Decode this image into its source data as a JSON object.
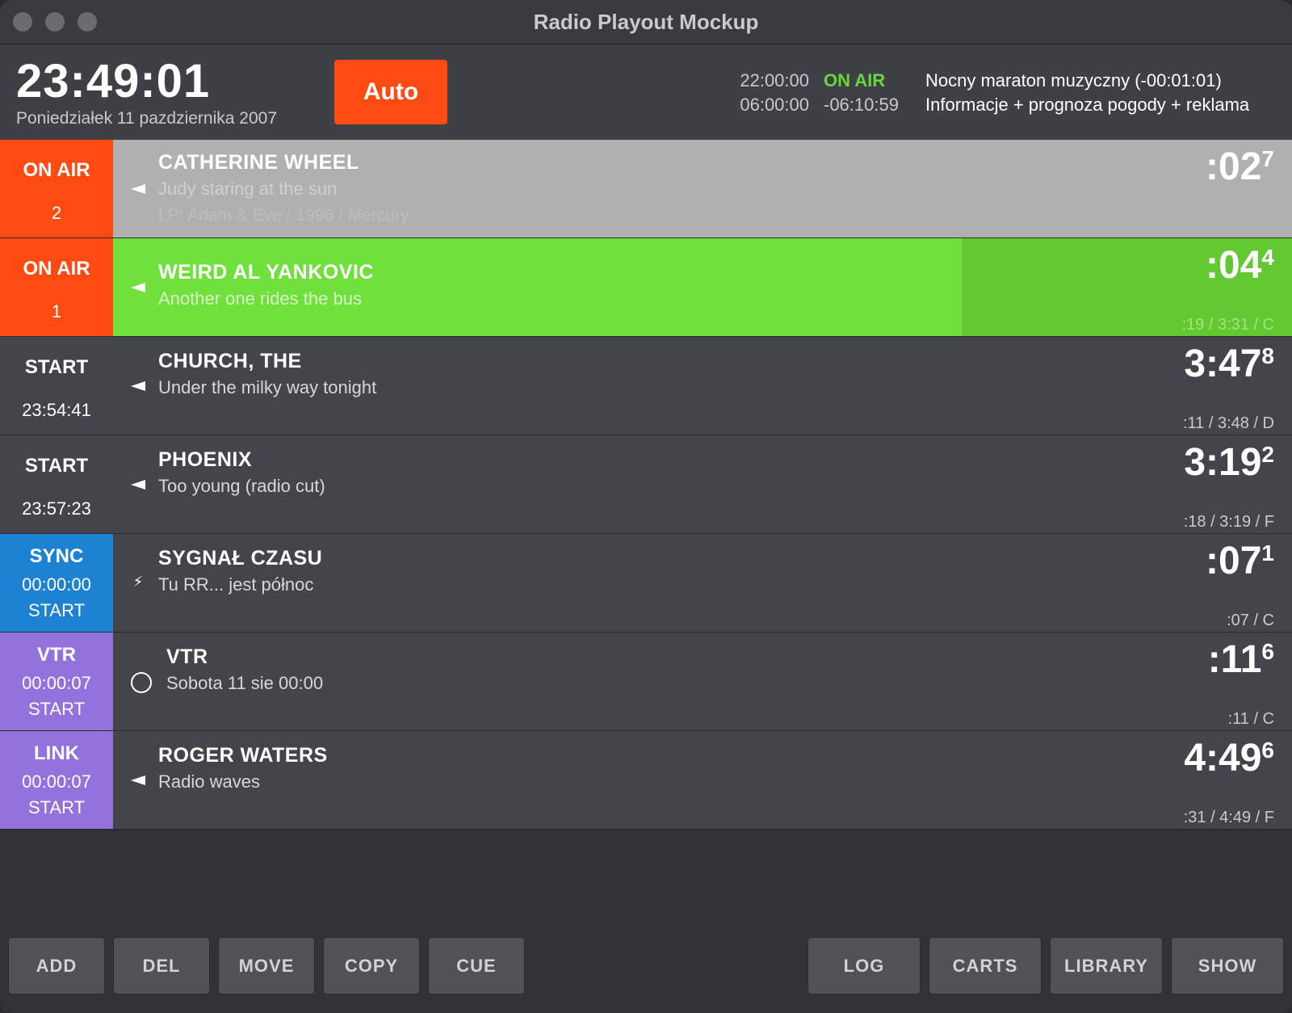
{
  "window": {
    "title": "Radio Playout Mockup"
  },
  "header": {
    "clock": "23:49:01",
    "date": "Poniedziałek 11 pazdziernika 2007",
    "mode_button": "Auto",
    "schedule": [
      {
        "time": "22:00:00",
        "status": "ON AIR",
        "description": "Nocny maraton muzyczny (-00:01:01)"
      },
      {
        "time": "06:00:00",
        "status": "-06:10:59",
        "description": "Informacje + prognoza pogody + reklama"
      }
    ]
  },
  "colors": {
    "on_air": "#ff4a12",
    "sync": "#1e82d2",
    "vtr_link": "#9272dc",
    "playing": "#6fe03c",
    "playing_remaining": "#62c933",
    "finishing": "#b0b0b0",
    "row": "#43454a"
  },
  "rows": [
    {
      "status": "ON AIR",
      "status2": "2",
      "status3": "",
      "icon": "speaker-icon",
      "artist": "CATHERINE WHEEL",
      "title": "Judy staring at the sun",
      "info": "LP: Adam & Eve / 1996 / Mercury",
      "duration": ":02",
      "duration_tenths": "7",
      "meta": ""
    },
    {
      "status": "ON AIR",
      "status2": "1",
      "status3": "",
      "icon": "speaker-icon",
      "artist": "WEIRD AL YANKOVIC",
      "title": "Another one rides the bus",
      "info": "",
      "duration": ":04",
      "duration_tenths": "4",
      "meta": ":19 / 3:31 / C",
      "progress": 0.72
    },
    {
      "status": "START",
      "status2": "23:54:41",
      "status3": "",
      "icon": "speaker-icon",
      "artist": "CHURCH, THE",
      "title": "Under the milky way tonight",
      "info": "",
      "duration": "3:47",
      "duration_tenths": "8",
      "meta": ":11 / 3:48 / D"
    },
    {
      "status": "START",
      "status2": "23:57:23",
      "status3": "",
      "icon": "speaker-icon",
      "artist": "PHOENIX",
      "title": "Too young (radio cut)",
      "info": "",
      "duration": "3:19",
      "duration_tenths": "2",
      "meta": ":18 / 3:19 / F"
    },
    {
      "status": "SYNC",
      "status2": "00:00:00",
      "status3": "START",
      "icon": "lightning-icon",
      "artist": "SYGNAŁ CZASU",
      "title": "Tu RR... jest północ",
      "info": "",
      "duration": ":07",
      "duration_tenths": "1",
      "meta": ":07 / C"
    },
    {
      "status": "VTR",
      "status2": "00:00:07",
      "status3": "START",
      "icon": "circle-icon",
      "artist": "VTR",
      "title": "Sobota 11 sie 00:00",
      "info": "",
      "duration": ":11",
      "duration_tenths": "6",
      "meta": ":11 / C"
    },
    {
      "status": "LINK",
      "status2": "00:00:07",
      "status3": "START",
      "icon": "speaker-icon",
      "artist": "ROGER WATERS",
      "title": "Radio waves",
      "info": "",
      "duration": "4:49",
      "duration_tenths": "6",
      "meta": ":31 / 4:49 / F"
    }
  ],
  "toolbar": {
    "left": [
      "ADD",
      "DEL",
      "MOVE",
      "COPY",
      "CUE"
    ],
    "right": [
      "LOG",
      "CARTS",
      "LIBRARY",
      "SHOW"
    ]
  }
}
